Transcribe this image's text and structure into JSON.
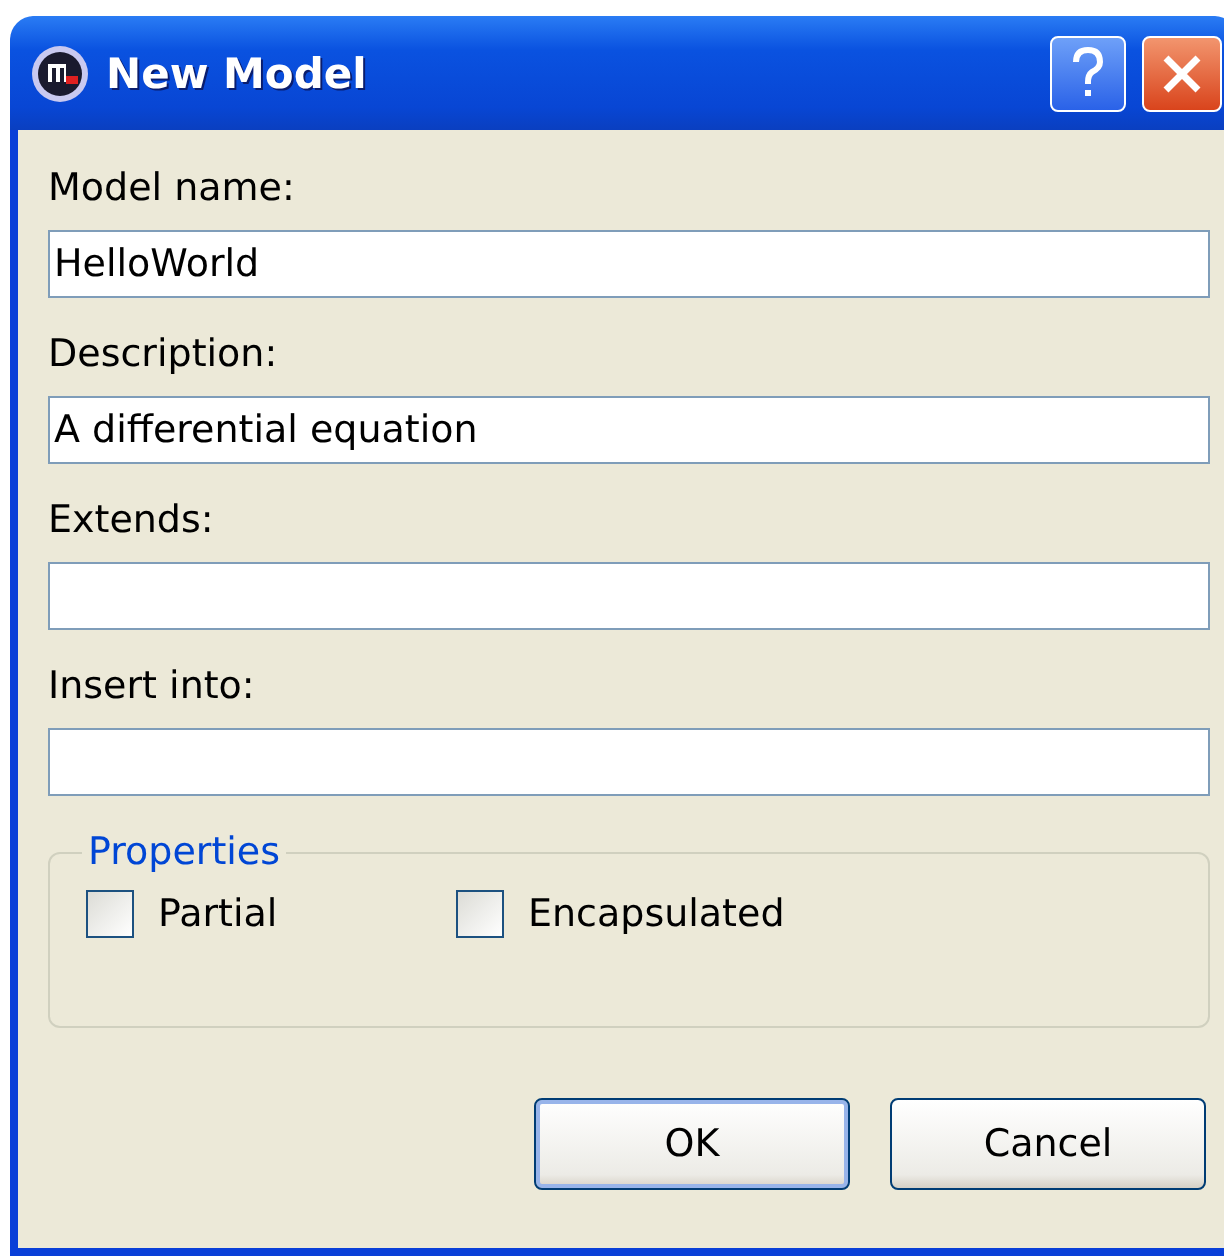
{
  "window": {
    "title": "New Model"
  },
  "fields": [
    {
      "label": "Model name:",
      "value": "HelloWorld"
    },
    {
      "label": "Description:",
      "value": "A differential equation"
    },
    {
      "label": "Extends:"
    },
    {
      "label": "Insert into:"
    }
  ],
  "properties": {
    "title": "Properties",
    "checkboxes": [
      {
        "label": "Partial",
        "checked": false
      },
      {
        "label": "Encapsulated",
        "checked": false
      }
    ]
  },
  "buttons": [
    {
      "label": "OK",
      "default": true
    },
    {
      "label": "Cancel",
      "default": false
    }
  ]
}
